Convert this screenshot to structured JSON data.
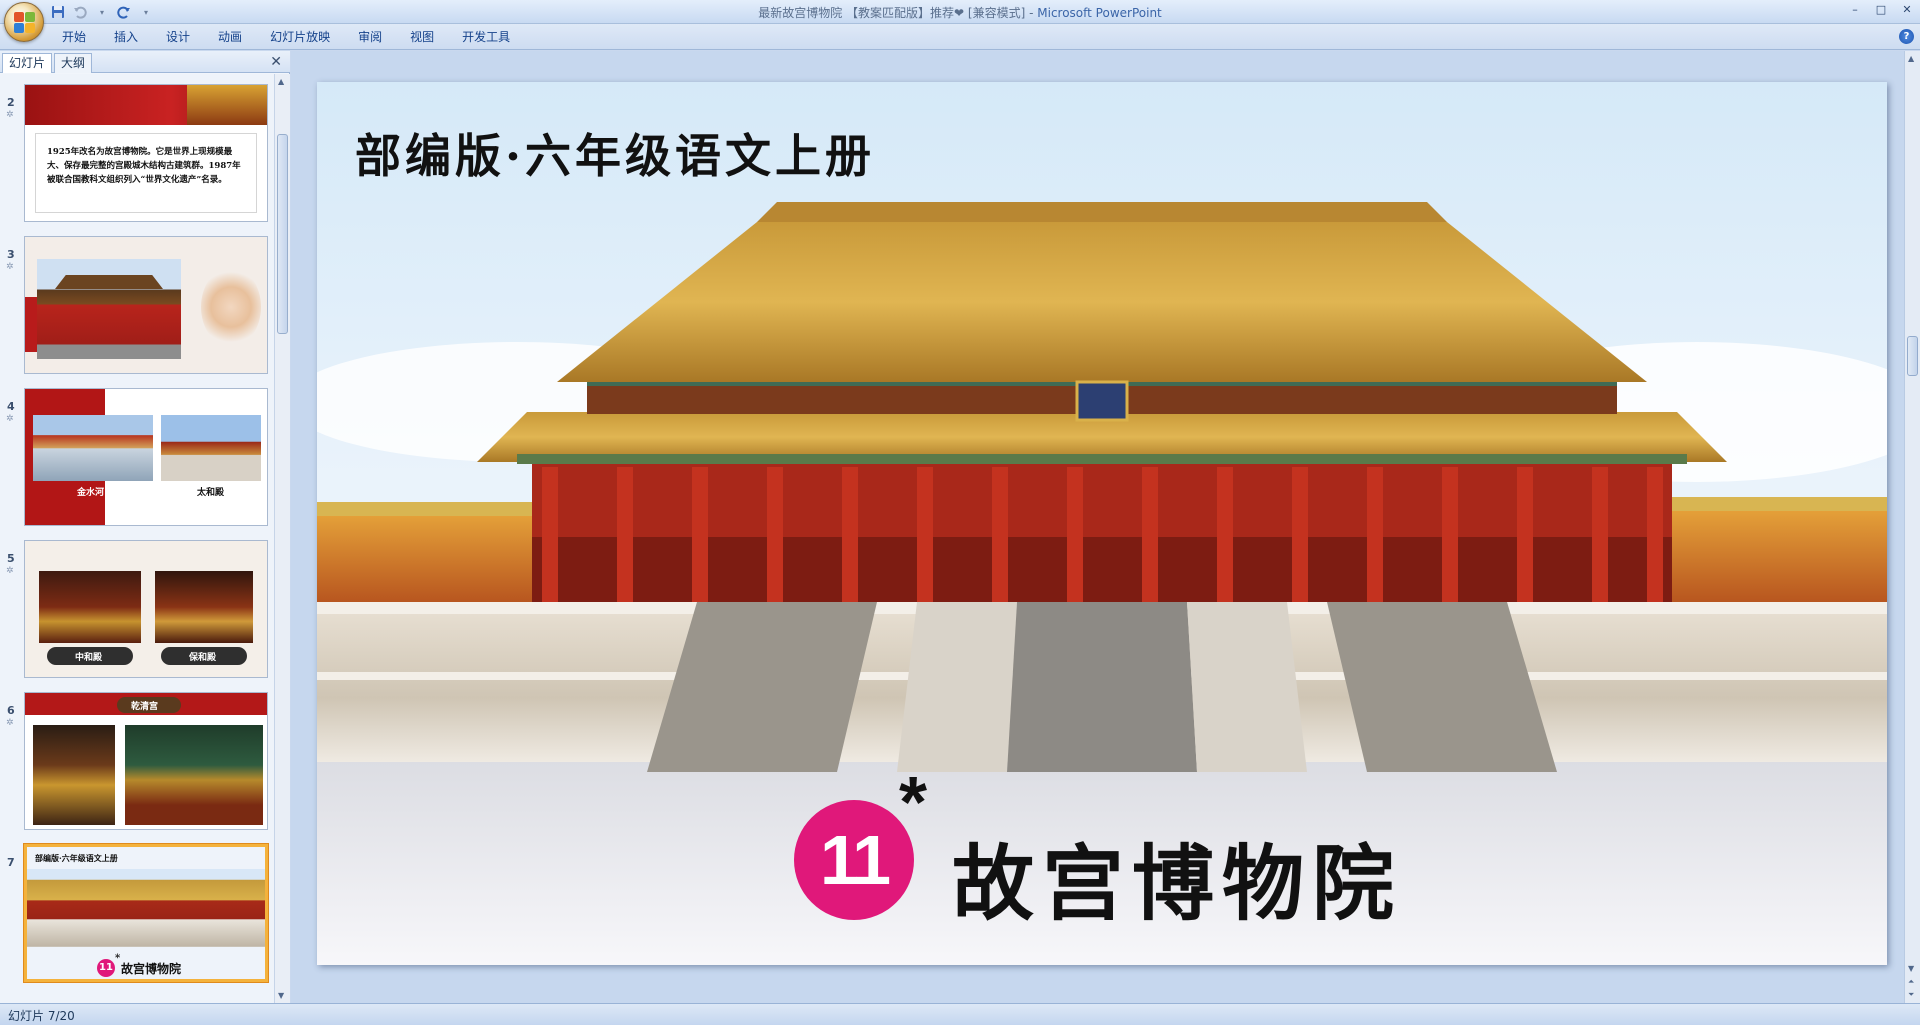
{
  "window": {
    "title": "最新故宫博物院 【教案匹配版】推荐❤ [兼容模式] - ",
    "app_name": "Microsoft PowerPoint",
    "controls": [
      "–",
      "□",
      "✕"
    ]
  },
  "qat": {
    "save_icon": "save-icon",
    "undo_icon": "undo-icon",
    "redo_icon": "redo-icon",
    "customize_icon": "chevron-down-icon"
  },
  "ribbon": {
    "tabs": [
      "开始",
      "插入",
      "设计",
      "动画",
      "幻灯片放映",
      "审阅",
      "视图",
      "开发工具"
    ],
    "help_label": "?"
  },
  "left_pane": {
    "tabs": [
      "幻灯片",
      "大纲"
    ],
    "close_label": "✕",
    "slides": [
      {
        "number": "2",
        "caption": "1925年改名为故宫博物院。它是世界上现规模最大、保存最完整的宫殿城木结构古建筑群。1987年被联合国教科文组织列入“世界文化遗产”名录。"
      },
      {
        "number": "3"
      },
      {
        "number": "4",
        "captions": [
          "金水河",
          "太和殿"
        ]
      },
      {
        "number": "5",
        "captions": [
          "中和殿",
          "保和殿"
        ]
      },
      {
        "number": "6",
        "captions": [
          "乾清宫"
        ]
      },
      {
        "number": "7",
        "subtitle": "部编版·六年级语文上册",
        "badge": "11",
        "star": "*",
        "title": "故宫博物院",
        "selected": true
      }
    ]
  },
  "slide": {
    "subtitle": "部编版·六年级语文上册",
    "lesson_number": "11",
    "asterisk": "*",
    "title": "故宫博物院"
  },
  "status": {
    "text": "幻灯片 7/20"
  },
  "colors": {
    "badge": "#e0187a",
    "ribbon": "#cddcf1",
    "canvas": "#c6d7ee",
    "selected_border": "#f4b23c"
  }
}
